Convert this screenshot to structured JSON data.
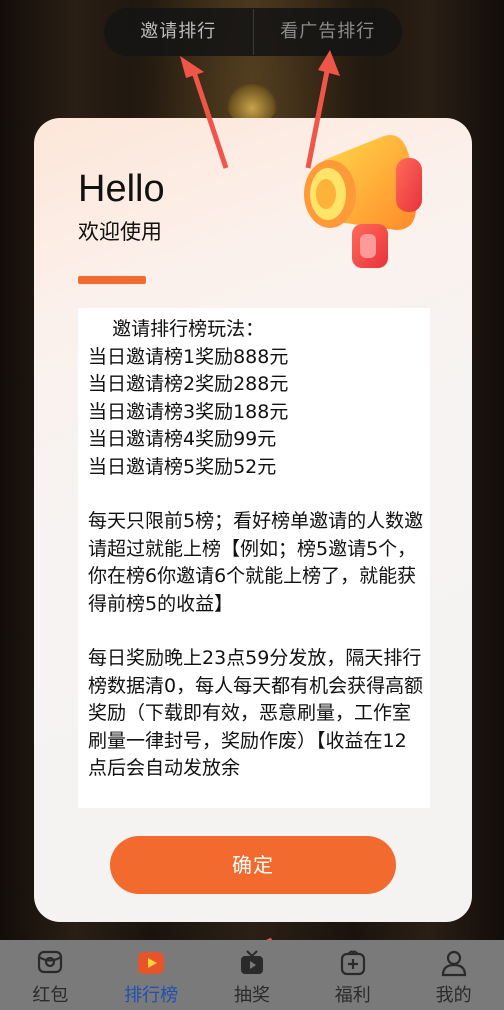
{
  "top_tabs": [
    {
      "label": "邀请排行",
      "active": true
    },
    {
      "label": "看广告排行",
      "active": false
    }
  ],
  "modal": {
    "title": "Hello",
    "subtitle": "欢迎使用",
    "rules_lines_1": [
      "    邀请排行榜玩法：",
      "当日邀请榜1奖励888元",
      "当日邀请榜2奖励288元",
      "当日邀请榜3奖励188元",
      "当日邀请榜4奖励99元",
      "当日邀请榜5奖励52元"
    ],
    "rules_para_2": "每天只限前5榜；看好榜单邀请的人数邀请超过就能上榜【例如；榜5邀请5个，你在榜6你邀请6个就能上榜了，就能获得前榜5的收益】",
    "rules_para_3": "每日奖励晚上23点59分发放，隔天排行榜数据清0，每人每天都有机会获得高额奖励（下载即有效，恶意刷量，工作室刷量一律封号，奖励作废）【收益在12点后会自动发放余",
    "confirm_label": "确定"
  },
  "bottom_nav": [
    {
      "label": "红包",
      "icon": "red-packet-icon",
      "active": false
    },
    {
      "label": "排行榜",
      "icon": "ranking-icon",
      "active": true
    },
    {
      "label": "抽奖",
      "icon": "lottery-tv-icon",
      "active": false
    },
    {
      "label": "福利",
      "icon": "welfare-gift-icon",
      "active": false
    },
    {
      "label": "我的",
      "icon": "user-icon",
      "active": false
    }
  ],
  "colors": {
    "accent": "#f26a2e",
    "active_nav": "#1f4fb3",
    "arrow": "#f0554a"
  }
}
